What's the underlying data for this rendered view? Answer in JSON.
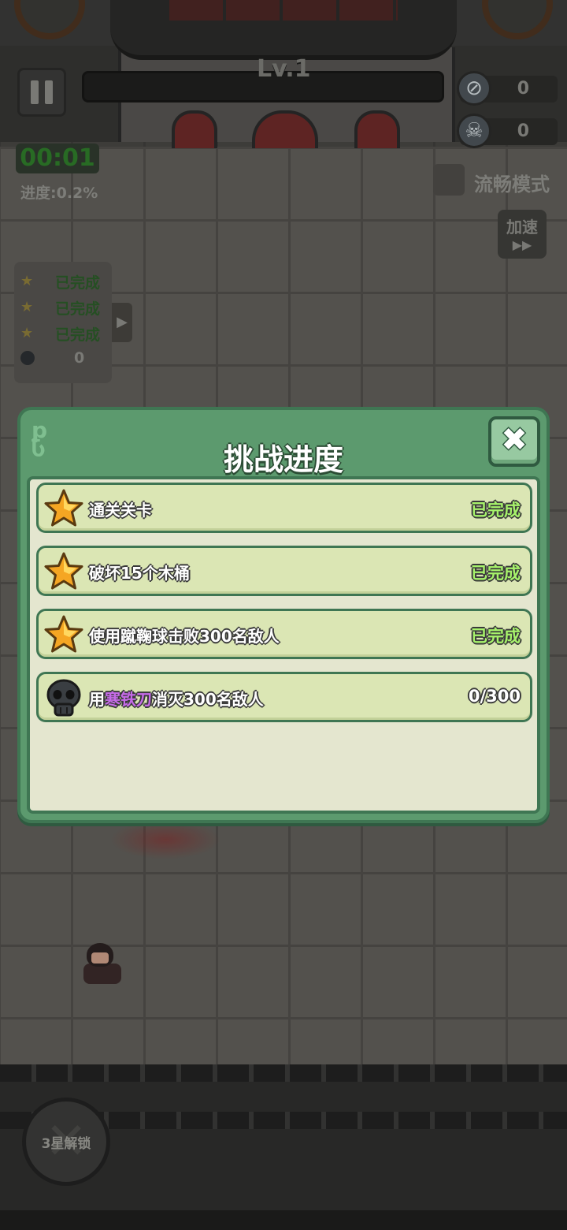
{
  "hud": {
    "level": "Lv.1",
    "coins": "0",
    "kills": "0",
    "timer": "00:01",
    "progress": "进度:0.2%",
    "smooth_mode": "流畅模式",
    "speed_up": "加速",
    "speed_arrow": "▶▶"
  },
  "star_panel": {
    "rows": [
      "已完成",
      "已完成",
      "已完成"
    ],
    "skull_count": "0"
  },
  "skill": {
    "lock_label": "3星解锁"
  },
  "dialog": {
    "title": "挑战进度",
    "tasks": [
      {
        "icon": "star-icon",
        "label": "通关关卡",
        "status": "已完成"
      },
      {
        "icon": "star-icon",
        "label": "破坏15个木桶",
        "status": "已完成"
      },
      {
        "icon": "star-icon",
        "label": "使用蹴鞠球击败300名敌人",
        "status": "已完成"
      },
      {
        "icon": "skull-icon",
        "label_pre": "用",
        "label_highlight": "寒铁刀",
        "label_post": "消灭300名敌人",
        "status": "0/300"
      }
    ]
  },
  "colors": {
    "dialog_green": "#5c9a6e",
    "done_green": "#a7f36b",
    "highlight_purple": "#c66be8",
    "task_bg": "#dbe6b4"
  }
}
